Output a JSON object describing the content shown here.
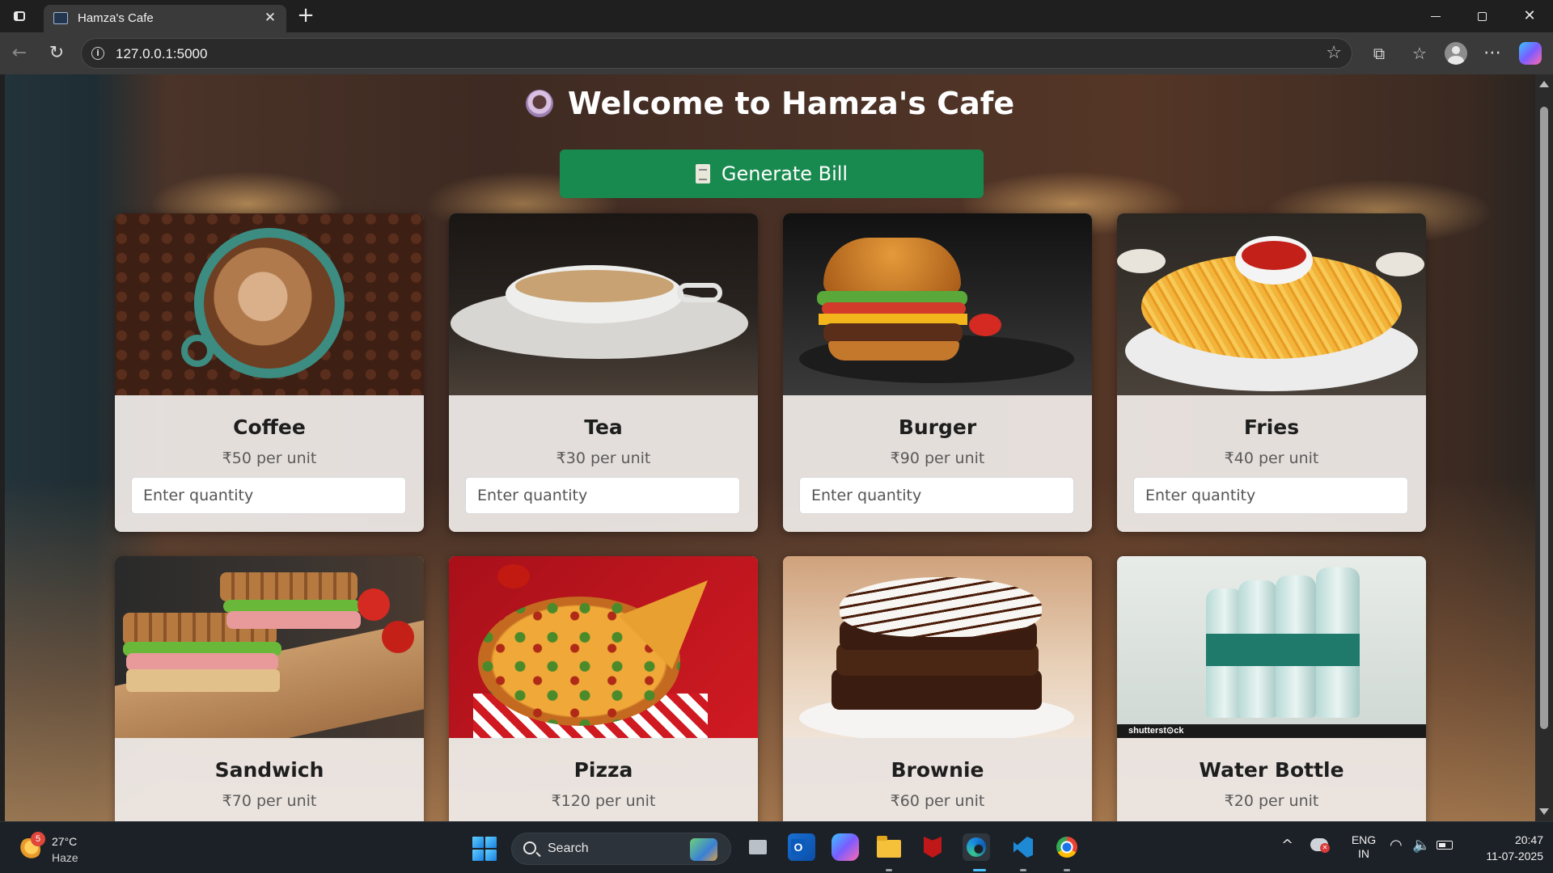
{
  "browser": {
    "tab_title": "Hamza's Cafe",
    "tab_close": "✕",
    "new_tab": "+",
    "url": "127.0.0.1:5000",
    "icons": [
      "tab-actions-icon",
      "favicon-icon",
      "back-icon",
      "reload-icon",
      "site-info-icon",
      "favorite-star-icon",
      "extensions-icon",
      "favorites-icon",
      "profile-icon",
      "more-icon",
      "copilot-icon"
    ]
  },
  "page": {
    "title": "Welcome to Hamza's Cafe",
    "title_icon": "coffee-cup-icon",
    "bill_button": "Generate Bill",
    "bill_icon": "receipt-icon",
    "quantity_placeholder": "Enter quantity",
    "accent_color": "#198a4f",
    "items": [
      {
        "name": "Coffee",
        "price": "₹50 per unit",
        "image": "coffee-image"
      },
      {
        "name": "Tea",
        "price": "₹30 per unit",
        "image": "tea-image"
      },
      {
        "name": "Burger",
        "price": "₹90 per unit",
        "image": "burger-image"
      },
      {
        "name": "Fries",
        "price": "₹40 per unit",
        "image": "fries-image"
      },
      {
        "name": "Sandwich",
        "price": "₹70 per unit",
        "image": "sandwich-image"
      },
      {
        "name": "Pizza",
        "price": "₹120 per unit",
        "image": "pizza-image"
      },
      {
        "name": "Brownie",
        "price": "₹60 per unit",
        "image": "brownie-image"
      },
      {
        "name": "Water Bottle",
        "price": "₹20 per unit",
        "image": "water-bottle-image"
      }
    ],
    "watermark": "shutterst⊙ck"
  },
  "taskbar": {
    "weather_badge": "5",
    "temperature": "27°C",
    "condition": "Haze",
    "search_label": "Search",
    "lang_line1": "ENG",
    "lang_line2": "IN",
    "time": "20:47",
    "date": "11-07-2025",
    "chevron": "^",
    "wifi": "◠",
    "volume": "🔈"
  }
}
